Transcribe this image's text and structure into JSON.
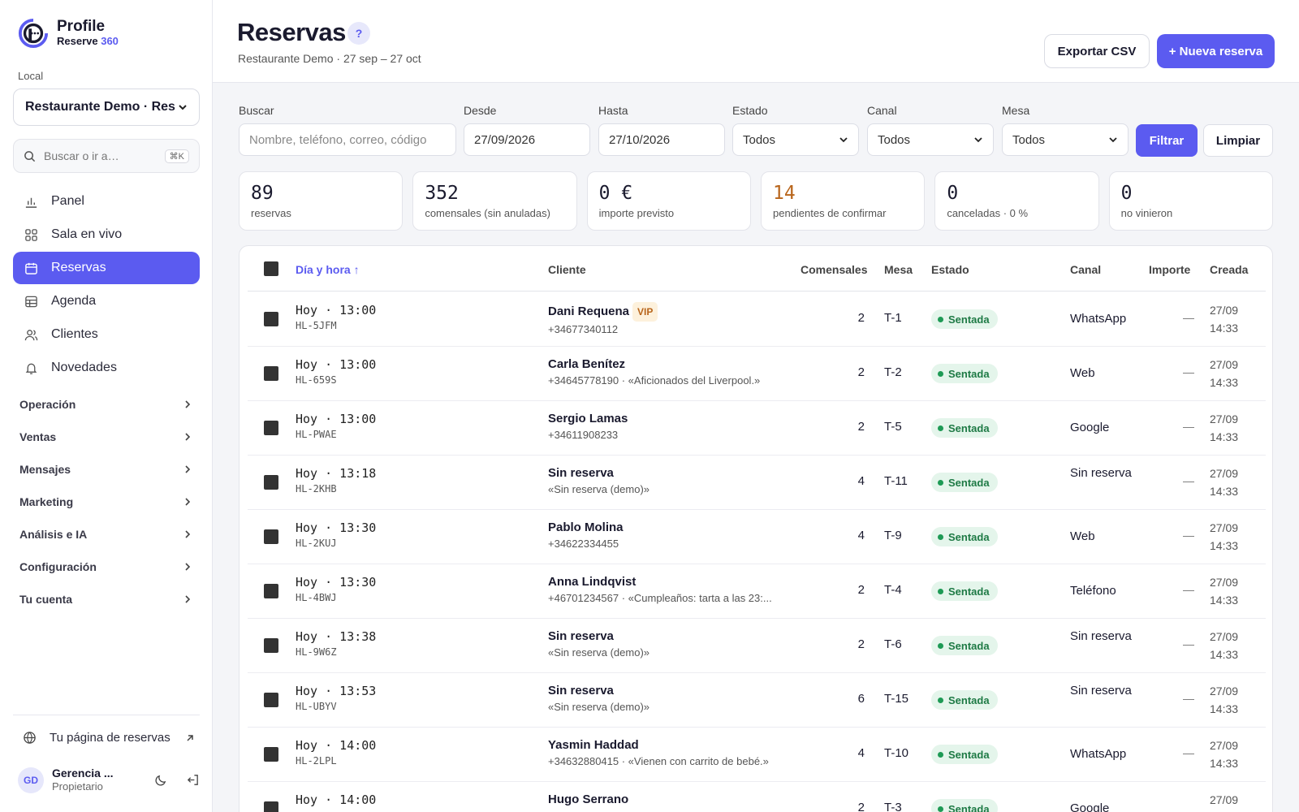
{
  "brand": {
    "name": "Profile",
    "sub_prefix": "Reserve ",
    "sub_accent": "360"
  },
  "sidebar": {
    "local_label": "Local",
    "local_value": "Restaurante Demo · Res",
    "search_placeholder": "Buscar o ir a…",
    "search_shortcut": "⌘K",
    "nav": [
      {
        "label": "Panel",
        "icon": "bar-chart-icon"
      },
      {
        "label": "Sala en vivo",
        "icon": "grid-icon"
      },
      {
        "label": "Reservas",
        "icon": "calendar-icon",
        "active": true
      },
      {
        "label": "Agenda",
        "icon": "table-icon"
      },
      {
        "label": "Clientes",
        "icon": "users-icon"
      },
      {
        "label": "Novedades",
        "icon": "bell-icon"
      }
    ],
    "groups": [
      "Operación",
      "Ventas",
      "Mensajes",
      "Marketing",
      "Análisis e IA",
      "Configuración",
      "Tu cuenta"
    ],
    "public_link": "Tu página de reservas",
    "user": {
      "initials": "GD",
      "name": "Gerencia ...",
      "role": "Propietario"
    }
  },
  "header": {
    "title": "Reservas",
    "help": "?",
    "subtitle": "Restaurante Demo · 27 sep – 27 oct",
    "export_label": "Exportar CSV",
    "new_label": "+ Nueva reserva"
  },
  "filters": {
    "search_label": "Buscar",
    "search_placeholder": "Nombre, teléfono, correo, código",
    "from_label": "Desde",
    "from_value": "27/09/2026",
    "to_label": "Hasta",
    "to_value": "27/10/2026",
    "estado_label": "Estado",
    "estado_value": "Todos",
    "canal_label": "Canal",
    "canal_value": "Todos",
    "mesa_label": "Mesa",
    "mesa_value": "Todos",
    "filter_label": "Filtrar",
    "clear_label": "Limpiar"
  },
  "stats": [
    {
      "value": "89",
      "label": "reservas"
    },
    {
      "value": "352",
      "label": "comensales (sin anuladas)"
    },
    {
      "value": "0 €",
      "label": "importe previsto"
    },
    {
      "value": "14",
      "label": "pendientes de confirmar",
      "warn": true
    },
    {
      "value": "0",
      "label": "canceladas · 0 %"
    },
    {
      "value": "0",
      "label": "no vinieron"
    }
  ],
  "table": {
    "headers": {
      "when": "Día y hora ↑",
      "client": "Cliente",
      "guests": "Comensales",
      "table": "Mesa",
      "status": "Estado",
      "channel": "Canal",
      "amount": "Importe",
      "created": "Creada"
    },
    "rows": [
      {
        "when": "Hoy · 13:00",
        "code": "HL-5JFM",
        "name": "Dani Requena",
        "vip": "VIP",
        "info": "+34677340112",
        "guests": "2",
        "table": "T-1",
        "status": "Sentada",
        "channel": "WhatsApp",
        "amount": "—",
        "created_date": "27/09",
        "created_time": "14:33"
      },
      {
        "when": "Hoy · 13:00",
        "code": "HL-659S",
        "name": "Carla Benítez",
        "info": "+34645778190 · «Aficionados del Liverpool.»",
        "guests": "2",
        "table": "T-2",
        "status": "Sentada",
        "channel": "Web",
        "amount": "—",
        "created_date": "27/09",
        "created_time": "14:33"
      },
      {
        "when": "Hoy · 13:00",
        "code": "HL-PWAE",
        "name": "Sergio Lamas",
        "info": "+34611908233",
        "guests": "2",
        "table": "T-5",
        "status": "Sentada",
        "channel": "Google",
        "amount": "—",
        "created_date": "27/09",
        "created_time": "14:33"
      },
      {
        "when": "Hoy · 13:18",
        "code": "HL-2KHB",
        "name": "Sin reserva",
        "info": "«Sin reserva (demo)»",
        "guests": "4",
        "table": "T-11",
        "status": "Sentada",
        "channel": "Sin reserva",
        "amount": "—",
        "created_date": "27/09",
        "created_time": "14:33"
      },
      {
        "when": "Hoy · 13:30",
        "code": "HL-2KUJ",
        "name": "Pablo Molina",
        "info": "+34622334455",
        "guests": "4",
        "table": "T-9",
        "status": "Sentada",
        "channel": "Web",
        "amount": "—",
        "created_date": "27/09",
        "created_time": "14:33"
      },
      {
        "when": "Hoy · 13:30",
        "code": "HL-4BWJ",
        "name": "Anna Lindqvist",
        "info": "+46701234567 · «Cumpleaños: tarta a las 23:...",
        "guests": "2",
        "table": "T-4",
        "status": "Sentada",
        "channel": "Teléfono",
        "amount": "—",
        "created_date": "27/09",
        "created_time": "14:33"
      },
      {
        "when": "Hoy · 13:38",
        "code": "HL-9W6Z",
        "name": "Sin reserva",
        "info": "«Sin reserva (demo)»",
        "guests": "2",
        "table": "T-6",
        "status": "Sentada",
        "channel": "Sin reserva",
        "amount": "—",
        "created_date": "27/09",
        "created_time": "14:33"
      },
      {
        "when": "Hoy · 13:53",
        "code": "HL-UBYV",
        "name": "Sin reserva",
        "info": "«Sin reserva (demo)»",
        "guests": "6",
        "table": "T-15",
        "status": "Sentada",
        "channel": "Sin reserva",
        "amount": "—",
        "created_date": "27/09",
        "created_time": "14:33"
      },
      {
        "when": "Hoy · 14:00",
        "code": "HL-2LPL",
        "name": "Yasmin Haddad",
        "info": "+34632880415 · «Vienen con carrito de bebé.»",
        "guests": "4",
        "table": "T-10",
        "status": "Sentada",
        "channel": "WhatsApp",
        "amount": "—",
        "created_date": "27/09",
        "created_time": "14:33"
      },
      {
        "when": "Hoy · 14:00",
        "code": "",
        "name": "Hugo Serrano",
        "info": "",
        "guests": "2",
        "table": "T-3",
        "status": "Sentada",
        "channel": "Google",
        "amount": "",
        "created_date": "27/09",
        "created_time": ""
      }
    ]
  }
}
